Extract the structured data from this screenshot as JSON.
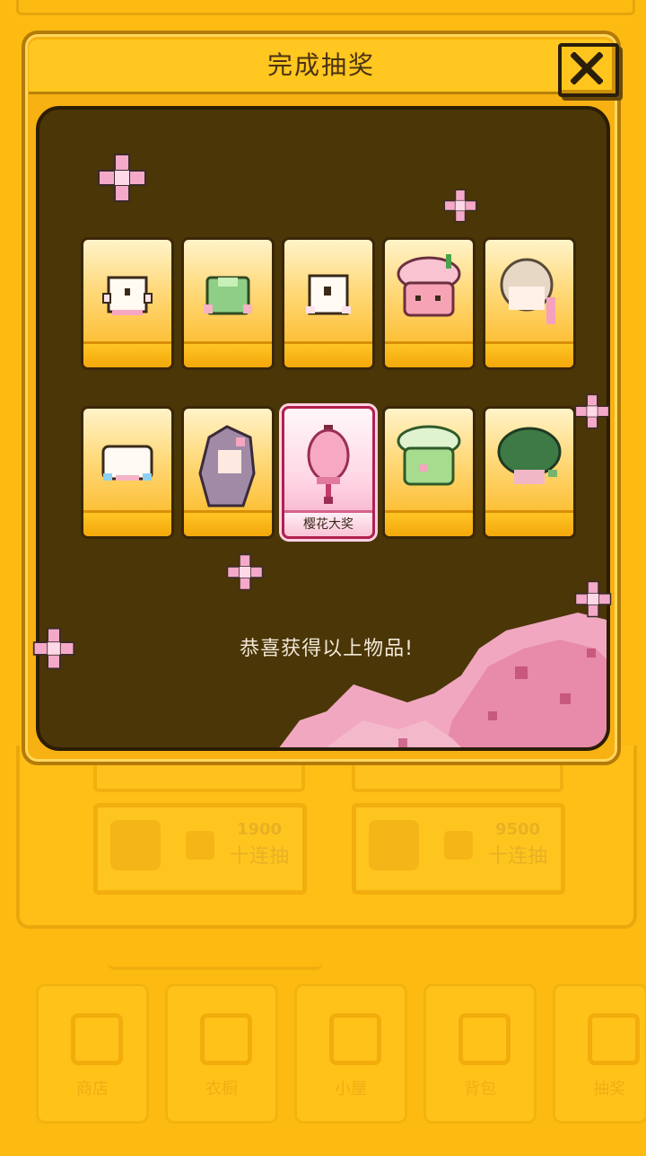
{
  "dialog": {
    "title": "完成抽奖",
    "close_label": "✕",
    "congrats_text": "恭喜获得以上物品!"
  },
  "prizes": [
    {
      "name": "white-cube-top",
      "caption": ""
    },
    {
      "name": "green-shirt",
      "caption": ""
    },
    {
      "name": "white-cube-dress",
      "caption": ""
    },
    {
      "name": "pink-cupcake-hat",
      "caption": ""
    },
    {
      "name": "blonde-hair",
      "caption": ""
    },
    {
      "name": "white-puff-shirt",
      "caption": ""
    },
    {
      "name": "purple-long-hair",
      "caption": ""
    },
    {
      "name": "pink-lantern",
      "caption": "樱花大奖",
      "grand": true
    },
    {
      "name": "green-cupcake-hat",
      "caption": ""
    },
    {
      "name": "green-bush-hat",
      "caption": ""
    }
  ],
  "background": {
    "buttons": [
      {
        "price": "1900",
        "label": "十连抽",
        "icon": "flower-coin-icon"
      },
      {
        "price": "9500",
        "label": "十连抽",
        "icon": "gem-coin-icon"
      }
    ],
    "tabs": [
      "商店",
      "衣橱",
      "小屋",
      "背包",
      "抽奖"
    ]
  },
  "colors": {
    "background": "#fdbb12",
    "dialog_body": "#4b3608",
    "card_gold": "#fbb418",
    "grand_pink": "#f4a8c3",
    "sakura": "#f29bbf"
  }
}
